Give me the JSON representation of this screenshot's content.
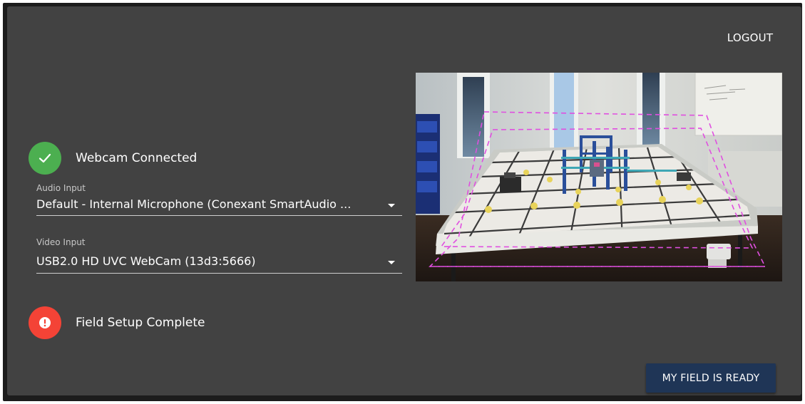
{
  "header": {
    "logout_label": "LOGOUT"
  },
  "webcam_status": {
    "label": "Webcam Connected",
    "icon": "check-icon",
    "color": "#4caf50"
  },
  "audio_input": {
    "label": "Audio Input",
    "value": "Default - Internal Microphone (Conexant SmartAudio ..."
  },
  "video_input": {
    "label": "Video Input",
    "value": "USB2.0 HD UVC WebCam (13d3:5666)"
  },
  "field_status": {
    "label": "Field Setup Complete",
    "icon": "exclamation-icon",
    "color": "#f44336"
  },
  "actions": {
    "ready_label": "MY FIELD IS READY"
  },
  "colors": {
    "panel": "#424242",
    "button": "#1f3556",
    "overlay_guide": "#e04fe0"
  }
}
